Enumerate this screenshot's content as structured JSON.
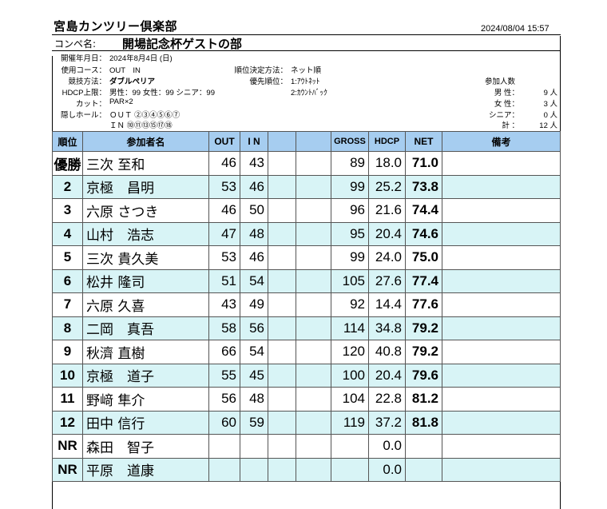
{
  "header": {
    "club": "宮島カンツリー倶楽部",
    "datetime": "2024/08/04 15:57",
    "compe_label": "コンペ名:",
    "compe_name": "開場記念杯ゲストの部"
  },
  "info": {
    "date_label": "開催年月日：",
    "date_value": "2024年8月4日 (日)",
    "course_label": "使用コース：",
    "course_value": "OUT　IN",
    "method_label": "競技方法：",
    "method_value": "ダブルペリア",
    "hdcp_label": "HDCP上限：",
    "hdcp_value": "男性：99 女性：99 シニア：99",
    "cut_label": "カット：",
    "cut_value": "PAR×2",
    "hidden_label": "隠しホール：",
    "hidden_out": "ＯＵＴ ②③④⑤⑥⑦",
    "hidden_in": "ＩＮ ⑩⑪⑬⑮⑰⑱",
    "rank_method_label": "順位決定方法：",
    "rank_method_value": "ネット順",
    "priority_label": "優先順位：",
    "priority_1": "1:ｱｳﾄﾈｯﾄ",
    "priority_2": "2:ｶｳﾝﾄﾊﾞｯｸ",
    "participants_label": "参加人数",
    "male_label": "男 性：",
    "male_value": "9 人",
    "female_label": "女 性：",
    "female_value": "3 人",
    "senior_label": "シニア：",
    "senior_value": "0 人",
    "total_label": "計 ：",
    "total_value": "12 人"
  },
  "table": {
    "headers": [
      "順位",
      "参加者名",
      "OUT",
      "I N",
      "",
      "",
      "GROSS",
      "HDCP",
      "NET",
      "備考"
    ],
    "rows": [
      {
        "rank": "優勝",
        "name": "三次 至和",
        "out": "46",
        "in": "43",
        "gross": "89",
        "hdcp": "18.0",
        "net": "71.0"
      },
      {
        "rank": "2",
        "name": "京極　昌明",
        "out": "53",
        "in": "46",
        "gross": "99",
        "hdcp": "25.2",
        "net": "73.8"
      },
      {
        "rank": "3",
        "name": "六原 さつき",
        "out": "46",
        "in": "50",
        "gross": "96",
        "hdcp": "21.6",
        "net": "74.4"
      },
      {
        "rank": "4",
        "name": "山村　浩志",
        "out": "47",
        "in": "48",
        "gross": "95",
        "hdcp": "20.4",
        "net": "74.6"
      },
      {
        "rank": "5",
        "name": "三次 貴久美",
        "out": "53",
        "in": "46",
        "gross": "99",
        "hdcp": "24.0",
        "net": "75.0"
      },
      {
        "rank": "6",
        "name": "松井 隆司",
        "out": "51",
        "in": "54",
        "gross": "105",
        "hdcp": "27.6",
        "net": "77.4"
      },
      {
        "rank": "7",
        "name": "六原 久喜",
        "out": "43",
        "in": "49",
        "gross": "92",
        "hdcp": "14.4",
        "net": "77.6"
      },
      {
        "rank": "8",
        "name": "二岡　真吾",
        "out": "58",
        "in": "56",
        "gross": "114",
        "hdcp": "34.8",
        "net": "79.2"
      },
      {
        "rank": "9",
        "name": "秋濟 直樹",
        "out": "66",
        "in": "54",
        "gross": "120",
        "hdcp": "40.8",
        "net": "79.2"
      },
      {
        "rank": "10",
        "name": "京極　道子",
        "out": "55",
        "in": "45",
        "gross": "100",
        "hdcp": "20.4",
        "net": "79.6"
      },
      {
        "rank": "11",
        "name": "野﨑 隼介",
        "out": "56",
        "in": "48",
        "gross": "104",
        "hdcp": "22.8",
        "net": "81.2"
      },
      {
        "rank": "12",
        "name": "田中 信行",
        "out": "60",
        "in": "59",
        "gross": "119",
        "hdcp": "37.2",
        "net": "81.8"
      },
      {
        "rank": "NR",
        "name": "森田　智子",
        "out": "",
        "in": "",
        "gross": "",
        "hdcp": "0.0",
        "net": ""
      },
      {
        "rank": "NR",
        "name": "平原　道康",
        "out": "",
        "in": "",
        "gross": "",
        "hdcp": "0.0",
        "net": ""
      }
    ]
  }
}
